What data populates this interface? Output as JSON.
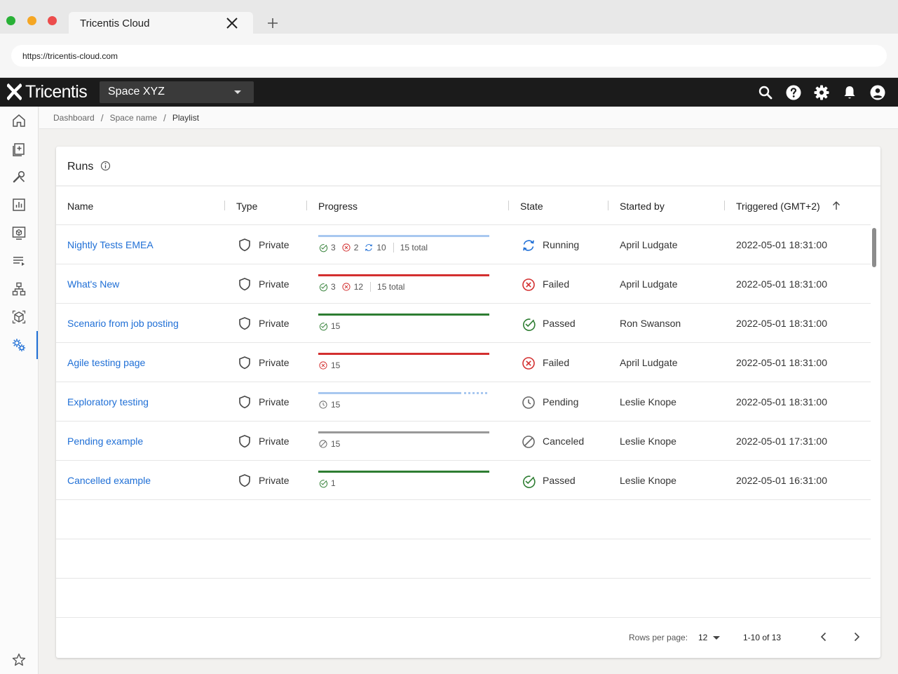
{
  "browser": {
    "tab_title": "Tricentis Cloud",
    "url": "https://tricentis-cloud.com"
  },
  "header": {
    "logo_text": "Tricentis",
    "space": "Space XYZ",
    "icons": [
      "search-icon",
      "help-icon",
      "settings-icon",
      "notifications-icon",
      "account-icon"
    ]
  },
  "sidenav": {
    "items": [
      "home-icon",
      "add-document-icon",
      "tools-icon",
      "chart-icon",
      "box-monitor-icon",
      "playlist-icon",
      "hierarchy-icon",
      "cube-icon",
      "settings-cog-icon"
    ],
    "bottom_icon": "star-icon",
    "active_index": 8
  },
  "breadcrumb": {
    "items": [
      "Dashboard",
      "Space name",
      "Playlist"
    ]
  },
  "card": {
    "title": "Runs"
  },
  "table": {
    "columns": {
      "name": "Name",
      "type": "Type",
      "progress": "Progress",
      "state": "State",
      "started_by": "Started by",
      "triggered": "Triggered (GMT+2)"
    },
    "rows": [
      {
        "name": "Nightly Tests EMEA",
        "type": "Private",
        "bar": "running",
        "stats": [
          {
            "kind": "passed",
            "value": "3"
          },
          {
            "kind": "failed",
            "value": "2"
          },
          {
            "kind": "running",
            "value": "10"
          }
        ],
        "total": "15 total",
        "state": "Running",
        "state_kind": "running",
        "started_by": "April Ludgate",
        "triggered": "2022-05-01 18:31:00"
      },
      {
        "name": "What's New",
        "type": "Private",
        "bar": "failed",
        "stats": [
          {
            "kind": "passed",
            "value": "3"
          },
          {
            "kind": "failed",
            "value": "12"
          }
        ],
        "total": "15 total",
        "state": "Failed",
        "state_kind": "failed",
        "started_by": "April Ludgate",
        "triggered": "2022-05-01 18:31:00"
      },
      {
        "name": "Scenario from  job posting",
        "type": "Private",
        "bar": "passed",
        "stats": [
          {
            "kind": "passed",
            "value": "15"
          }
        ],
        "total": "",
        "state": "Passed",
        "state_kind": "passed",
        "started_by": "Ron Swanson",
        "triggered": "2022-05-01 18:31:00"
      },
      {
        "name": "Agile testing page",
        "type": "Private",
        "bar": "failed",
        "stats": [
          {
            "kind": "failed",
            "value": "15"
          }
        ],
        "total": "",
        "state": "Failed",
        "state_kind": "failed",
        "started_by": "April Ludgate",
        "triggered": "2022-05-01 18:31:00"
      },
      {
        "name": "Exploratory testing",
        "type": "Private",
        "bar": "pending",
        "stats": [
          {
            "kind": "pending",
            "value": "15"
          }
        ],
        "total": "",
        "state": "Pending",
        "state_kind": "pending",
        "started_by": "Leslie Knope",
        "triggered": "2022-05-01 18:31:00"
      },
      {
        "name": "Pending example",
        "type": "Private",
        "bar": "canceled",
        "stats": [
          {
            "kind": "canceled",
            "value": "15"
          }
        ],
        "total": "",
        "state": "Canceled",
        "state_kind": "canceled",
        "started_by": "Leslie Knope",
        "triggered": "2022-05-01 17:31:00"
      },
      {
        "name": "Cancelled example",
        "type": "Private",
        "bar": "passed",
        "stats": [
          {
            "kind": "passed",
            "value": "1"
          }
        ],
        "total": "",
        "state": "Passed",
        "state_kind": "passed",
        "started_by": "Leslie Knope",
        "triggered": "2022-05-01 16:31:00"
      }
    ]
  },
  "footer": {
    "rows_per_page_label": "Rows per page:",
    "rows_per_page": "12",
    "range": "1-10 of 13"
  },
  "colors": {
    "link": "#1f6fd6",
    "passed": "#2e7d32",
    "failed": "#d32f2f",
    "running": "#1f6fd6",
    "running_bar": "#a8c8f0",
    "pending": "#666666",
    "canceled": "#999999"
  }
}
